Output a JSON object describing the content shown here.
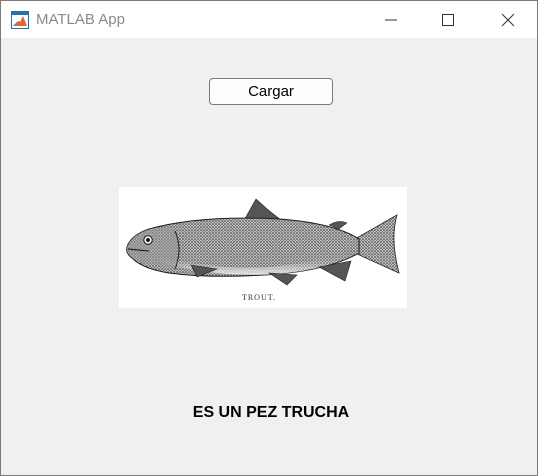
{
  "window": {
    "title": "MATLAB App",
    "controls": {
      "minimize_icon": "minimize-icon",
      "maximize_icon": "maximize-icon",
      "close_icon": "close-icon"
    }
  },
  "main": {
    "load_button_label": "Cargar",
    "image": {
      "caption": "TROUT."
    },
    "result_text": "ES UN PEZ TRUCHA"
  },
  "colors": {
    "titlebar_bg": "#ffffff",
    "window_bg": "#f0f0f0",
    "title_text": "#8a8a8a",
    "matlab_orange": "#e16737"
  }
}
